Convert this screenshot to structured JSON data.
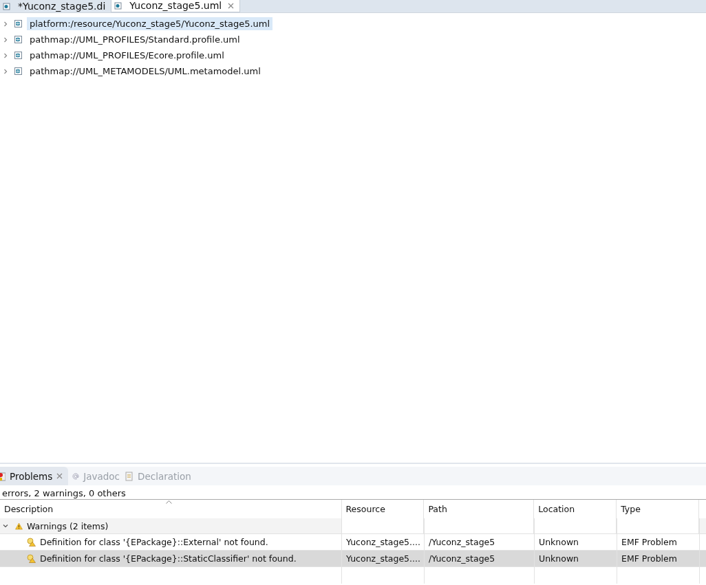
{
  "editor_tabs": [
    {
      "label": "*Yuconz_stage5.di",
      "selected": false,
      "closable": false
    },
    {
      "label": "Yuconz_stage5.uml",
      "selected": true,
      "closable": true
    }
  ],
  "tree": {
    "items": [
      {
        "label": "platform:/resource/Yuconz_stage5/Yuconz_stage5.uml",
        "selected": true,
        "expanded": false
      },
      {
        "label": "pathmap://UML_PROFILES/Standard.profile.uml",
        "selected": false,
        "expanded": false
      },
      {
        "label": "pathmap://UML_PROFILES/Ecore.profile.uml",
        "selected": false,
        "expanded": false
      },
      {
        "label": "pathmap://UML_METAMODELS/UML.metamodel.uml",
        "selected": false,
        "expanded": false
      }
    ]
  },
  "panel_tabs": [
    {
      "label": "Problems",
      "selected": true,
      "closable": true,
      "kind": "problems"
    },
    {
      "label": "Javadoc",
      "selected": false,
      "closable": false,
      "kind": "javadoc"
    },
    {
      "label": "Declaration",
      "selected": false,
      "closable": false,
      "kind": "declaration"
    }
  ],
  "summary": "errors, 2 warnings, 0 others",
  "table": {
    "columns": [
      "Description",
      "Resource",
      "Path",
      "Location",
      "Type"
    ],
    "groups": [
      {
        "label": "Warnings (2 items)",
        "expanded": true,
        "rows": [
          {
            "cells": [
              "Definition for class '{EPackage}::External' not found.",
              "Yuconz_stage5....",
              "/Yuconz_stage5",
              "Unknown",
              "EMF Problem"
            ],
            "selected": false
          },
          {
            "cells": [
              "Definition for class '{EPackage}::StaticClassifier' not found.",
              "Yuconz_stage5....",
              "/Yuconz_stage5",
              "Unknown",
              "EMF Problem"
            ],
            "selected": true
          }
        ]
      }
    ]
  }
}
